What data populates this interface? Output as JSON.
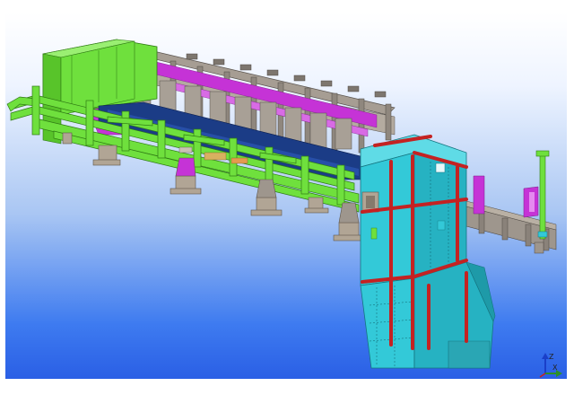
{
  "viewport": {
    "model": "3d-steel-conveyor-structure",
    "colors": {
      "structure_green": "#6fe03d",
      "hopper_cyan": "#33c9d8",
      "rail_gray": "#9e968d",
      "purple_parts": "#c533d6",
      "channel_blue": "#1b3c86",
      "red_bands": "#c42222",
      "support_tan": "#b1a595"
    }
  },
  "axis_triad": {
    "z_label": "Z",
    "x_label": "X",
    "icon": "axis-triad-icon"
  }
}
